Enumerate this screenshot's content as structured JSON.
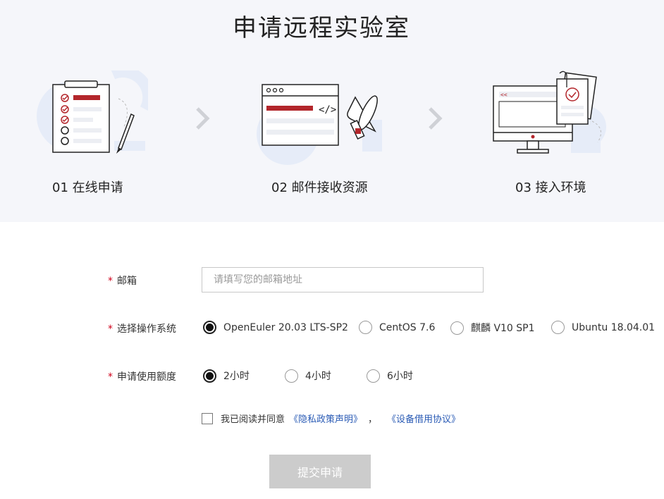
{
  "page": {
    "title": "申请远程实验室"
  },
  "steps": [
    {
      "label": "01 在线申请"
    },
    {
      "label": "02 邮件接收资源"
    },
    {
      "label": "03  接入环境"
    }
  ],
  "form": {
    "email": {
      "label": "邮箱",
      "placeholder": "请填写您的邮箱地址",
      "value": ""
    },
    "os": {
      "label": "选择操作系统",
      "options": [
        "OpenEuler 20.03 LTS-SP2",
        "CentOS 7.6",
        "麒麟 V10 SP1",
        "Ubuntu 18.04.01"
      ],
      "selected": "OpenEuler 20.03 LTS-SP2"
    },
    "quota": {
      "label": "申请使用额度",
      "options": [
        "2小时",
        "4小时",
        "6小时"
      ],
      "selected": "2小时"
    },
    "agreement": {
      "text": "我已阅读并同意",
      "privacy_link": "《隐私政策声明》",
      "separator": "，",
      "device_link": "《设备借用协议》",
      "checked": false
    },
    "required_mark": "*",
    "submit_label": "提交申请"
  },
  "colors": {
    "accent_red": "#b3262b",
    "link_blue": "#2a5bb5",
    "banner_bg": "#f5f6fa",
    "button_disabled": "#cccccc"
  }
}
